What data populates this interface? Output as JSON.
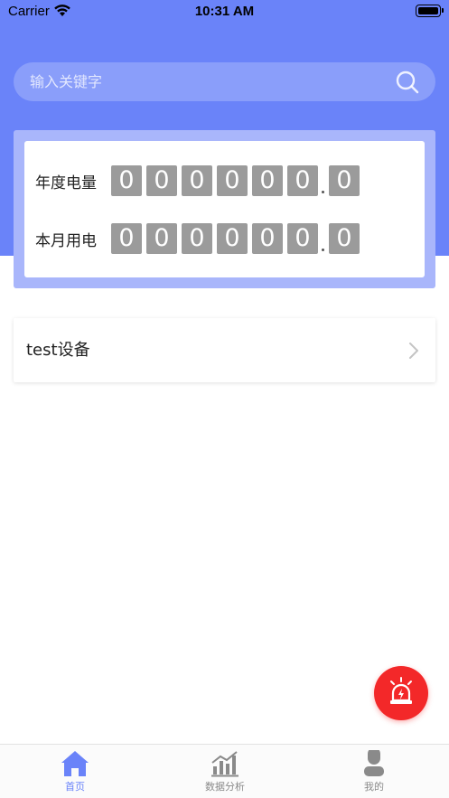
{
  "status_bar": {
    "carrier": "Carrier",
    "time": "10:31 AM"
  },
  "search": {
    "placeholder": "输入关键字"
  },
  "meter": {
    "annual": {
      "label": "年度电量",
      "integer_digits": [
        "0",
        "0",
        "0",
        "0",
        "0",
        "0"
      ],
      "decimal_digit": "0"
    },
    "monthly": {
      "label": "本月用电",
      "integer_digits": [
        "0",
        "0",
        "0",
        "0",
        "0",
        "0"
      ],
      "decimal_digit": "0"
    }
  },
  "devices": [
    {
      "name": "test设备"
    }
  ],
  "tabbar": {
    "home": "首页",
    "analysis": "数据分析",
    "mine": "我的"
  },
  "colors": {
    "primary": "#6a83f9",
    "alarm": "#f32829",
    "digit_bg": "#9b9b9b"
  }
}
